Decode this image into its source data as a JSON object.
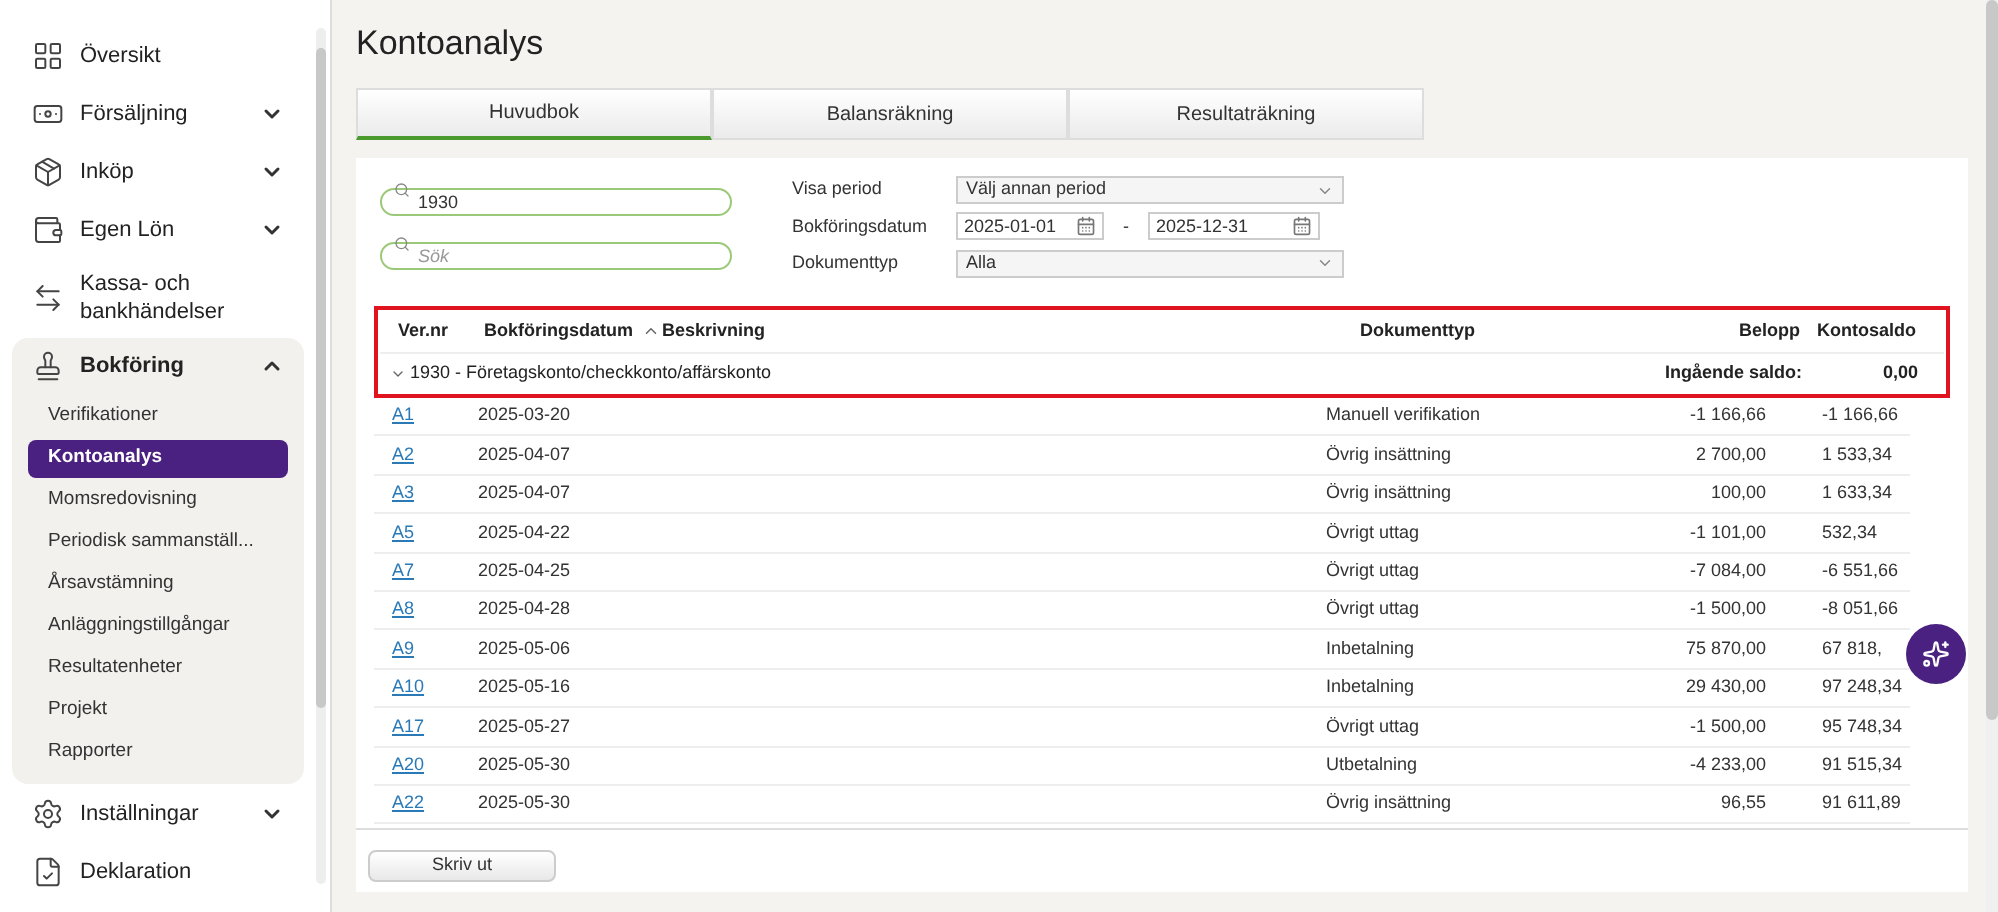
{
  "sidebar": {
    "items": [
      {
        "label": "Översikt"
      },
      {
        "label": "Försäljning",
        "expanded": false
      },
      {
        "label": "Inköp",
        "expanded": false
      },
      {
        "label": "Egen Lön",
        "expanded": false
      },
      {
        "label": "Kassa- och bankhändelser"
      },
      {
        "label": "Bokföring",
        "expanded": true,
        "children": [
          {
            "label": "Verifikationer",
            "selected": false
          },
          {
            "label": "Kontoanalys",
            "selected": true
          },
          {
            "label": "Momsredovisning",
            "selected": false
          },
          {
            "label": "Periodisk sammanställ...",
            "selected": false
          },
          {
            "label": "Årsavstämning",
            "selected": false
          },
          {
            "label": "Anläggningstillgångar",
            "selected": false
          },
          {
            "label": "Resultatenheter",
            "selected": false
          },
          {
            "label": "Projekt",
            "selected": false
          },
          {
            "label": "Rapporter",
            "selected": false
          }
        ]
      },
      {
        "label": "Inställningar",
        "expanded": false
      },
      {
        "label": "Deklaration"
      }
    ]
  },
  "page_title": "Kontoanalys",
  "tabs": [
    {
      "label": "Huvudbok",
      "selected": true
    },
    {
      "label": "Balansräkning",
      "selected": false
    },
    {
      "label": "Resultaträkning",
      "selected": false
    }
  ],
  "filters": {
    "account_search": {
      "value": "1930"
    },
    "search": {
      "placeholder": "Sök"
    },
    "period": {
      "label": "Visa period",
      "value": "Välj annan period"
    },
    "date": {
      "label": "Bokföringsdatum",
      "from": "2025-01-01",
      "separator": "-",
      "to": "2025-12-31"
    },
    "document_type": {
      "label": "Dokumenttyp",
      "value": "Alla"
    }
  },
  "table": {
    "columns": [
      {
        "label": "Ver.nr",
        "sorted": false
      },
      {
        "label": "Bokföringsdatum",
        "sorted": true
      },
      {
        "label": "Beskrivning",
        "sorted": false
      },
      {
        "label": "Dokumenttyp",
        "sorted": false
      },
      {
        "label": "Belopp",
        "sorted": false
      },
      {
        "label": "Kontosaldo",
        "sorted": false
      }
    ],
    "group": {
      "label": "1930 - Företagskonto/checkkonto/affärskonto",
      "expanded": true,
      "opening_label": "Ingående saldo:",
      "opening_value": "0,00"
    },
    "rows": [
      {
        "ver": "A1",
        "date": "2025-03-20",
        "document_type": "Manuell verifikation",
        "amount": "-1 166,66",
        "balance": "-1 166,66"
      },
      {
        "ver": "A2",
        "date": "2025-04-07",
        "document_type": "Övrig insättning",
        "amount": "2 700,00",
        "balance": "1 533,34"
      },
      {
        "ver": "A3",
        "date": "2025-04-07",
        "document_type": "Övrig insättning",
        "amount": "100,00",
        "balance": "1 633,34"
      },
      {
        "ver": "A5",
        "date": "2025-04-22",
        "document_type": "Övrigt uttag",
        "amount": "-1 101,00",
        "balance": "532,34"
      },
      {
        "ver": "A7",
        "date": "2025-04-25",
        "document_type": "Övrigt uttag",
        "amount": "-7 084,00",
        "balance": "-6 551,66"
      },
      {
        "ver": "A8",
        "date": "2025-04-28",
        "document_type": "Övrigt uttag",
        "amount": "-1 500,00",
        "balance": "-8 051,66"
      },
      {
        "ver": "A9",
        "date": "2025-05-06",
        "document_type": "Inbetalning",
        "amount": "75 870,00",
        "balance": "67 818,"
      },
      {
        "ver": "A10",
        "date": "2025-05-16",
        "document_type": "Inbetalning",
        "amount": "29 430,00",
        "balance": "97 248,34"
      },
      {
        "ver": "A17",
        "date": "2025-05-27",
        "document_type": "Övrigt uttag",
        "amount": "-1 500,00",
        "balance": "95 748,34"
      },
      {
        "ver": "A20",
        "date": "2025-05-30",
        "document_type": "Utbetalning",
        "amount": "-4 233,00",
        "balance": "91 515,34"
      },
      {
        "ver": "A22",
        "date": "2025-05-30",
        "document_type": "Övrig insättning",
        "amount": "96,55",
        "balance": "91 611,89"
      }
    ]
  },
  "print_button": "Skriv ut"
}
